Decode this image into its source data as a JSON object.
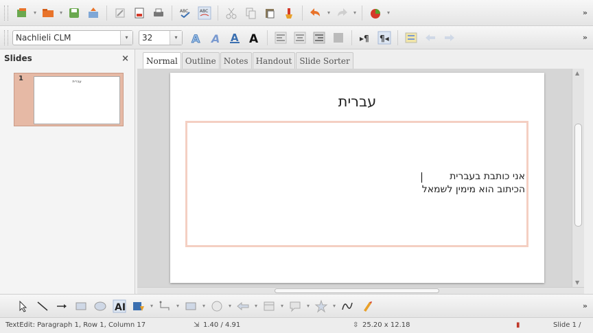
{
  "toolbar_more": "»",
  "font": {
    "name": "Nachlieli CLM",
    "size": "32"
  },
  "slides_pane": {
    "title": "Slides",
    "close": "×",
    "thumbnail_number": "1",
    "thumbnail_title": "עברית"
  },
  "tabs": [
    "Normal",
    "Outline",
    "Notes",
    "Handout",
    "Slide Sorter"
  ],
  "slide": {
    "title": "עברית",
    "lines": [
      "אני כותבת בעברית",
      "הכיתוב הוא מימין לשמאל"
    ]
  },
  "status": {
    "edit_info": "TextEdit: Paragraph 1, Row 1, Column 17",
    "position": "1.40 / 4.91",
    "size": "25.20 x 12.18",
    "slide_info": "Slide 1 /"
  },
  "icons": {
    "colors": {
      "orange": "#e8732a",
      "green": "#5aa02c",
      "blue": "#3a6fb0",
      "red": "#d43a2a",
      "gray": "#9a9a9a"
    }
  }
}
